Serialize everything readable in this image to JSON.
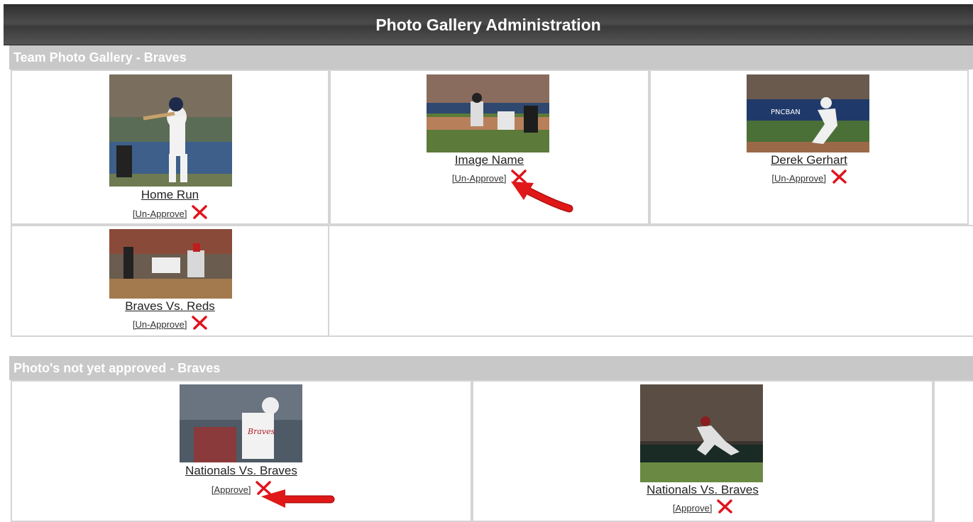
{
  "header": {
    "title": "Photo Gallery Administration"
  },
  "gallery": {
    "title": "Team Photo Gallery - Braves",
    "items": [
      {
        "name": "Home Run",
        "action": "[Un-Approve]"
      },
      {
        "name": "Image Name",
        "action": "[Un-Approve]"
      },
      {
        "name": "Derek Gerhart",
        "action": "[Un-Approve]"
      },
      {
        "name": "Braves Vs. Reds",
        "action": "[Un-Approve]"
      }
    ]
  },
  "pending": {
    "title": "Photo's not yet approved - Braves",
    "items": [
      {
        "name": "Nationals Vs. Braves",
        "action": "[Approve]"
      },
      {
        "name": "Nationals Vs. Braves",
        "action": "[Approve]"
      }
    ]
  },
  "icons": {
    "delete": "red-x-icon",
    "annotation": "red-arrow-icon"
  },
  "colors": {
    "delete_red": "#e0141e",
    "arrow_red": "#e01818",
    "header_gray": "#c8c8c8"
  }
}
